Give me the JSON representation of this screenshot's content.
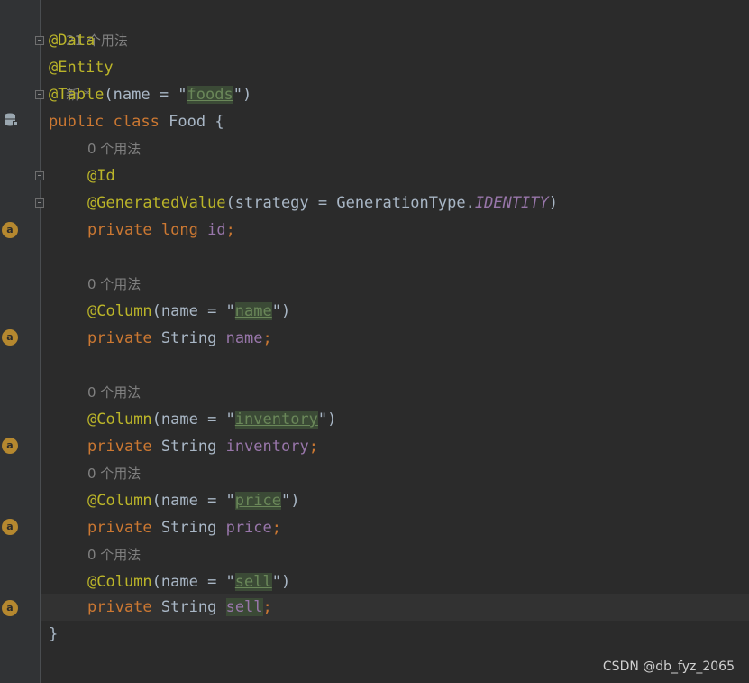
{
  "header_hint": {
    "count": "21 个用法",
    "new": "新 *"
  },
  "hints": {
    "zero_usages": "0 个用法"
  },
  "code": {
    "ann_data": "@Data",
    "ann_entity": "@Entity",
    "ann_table": "@Table",
    "table_args_open": "(name = \"",
    "table_name": "foods",
    "args_close": "\")",
    "kw_public": "public",
    "kw_class": "class",
    "class_name": "Food",
    "brace_open": "{",
    "ann_id": "@Id",
    "ann_generated": "@GeneratedValue",
    "gen_args_open": "(strategy = GenerationType.",
    "gen_strategy": "IDENTITY",
    "gen_close": ")",
    "kw_private": "private",
    "kw_long": "long",
    "field_id": "id",
    "semicolon": ";",
    "ann_column": "@Column",
    "col_args_open": "(name = \"",
    "col_name": "name",
    "col_inventory": "inventory",
    "col_price": "price",
    "col_sell": "sell",
    "type_string": "String",
    "field_name": "name",
    "field_inventory": "inventory",
    "field_price": "price",
    "field_sell": "sell",
    "brace_close": "}"
  },
  "gutter": {
    "field_marker": "a",
    "id_marker": "a"
  },
  "watermark": "CSDN @db_fyz_2065",
  "colors": {
    "background": "#2b2b2b",
    "keyword": "#cc7832",
    "annotation": "#bbb529",
    "string": "#6a8759",
    "field": "#9876aa"
  }
}
